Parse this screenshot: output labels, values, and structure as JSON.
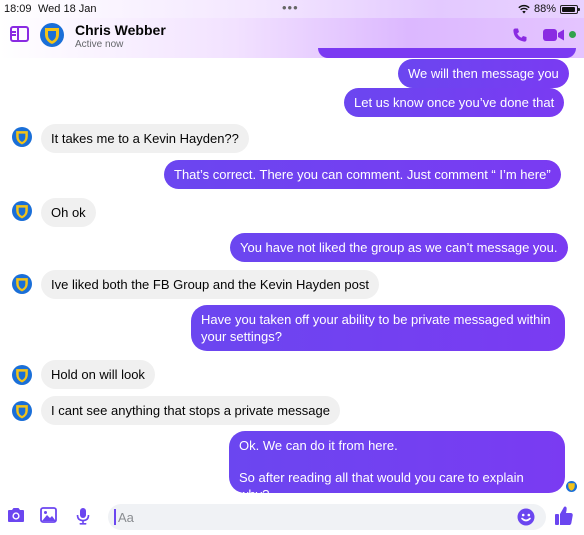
{
  "status_bar": {
    "time": "18:09",
    "date": "Wed 18 Jan",
    "dots": "•••",
    "battery": "88%"
  },
  "header": {
    "contact_name": "Chris Webber",
    "contact_status": "Active now",
    "icons": [
      "sidebar-toggle-icon",
      "avatar-shield-icon",
      "phone-icon",
      "video-camera-icon"
    ]
  },
  "colors": {
    "outgoing_bubble": "#7a3bf2",
    "incoming_bubble": "#f0f0f0",
    "accent": "#8a2be2",
    "active_dot": "#31a24c"
  },
  "messages": [
    {
      "direction": "outgoing",
      "text": "We will then message you"
    },
    {
      "direction": "outgoing",
      "text": "Let us know once you’ve done that"
    },
    {
      "direction": "incoming",
      "text": "It takes me to a Kevin Hayden??"
    },
    {
      "direction": "outgoing",
      "text": "That’s correct. There you can comment. Just comment “ I’m here”"
    },
    {
      "direction": "incoming",
      "text": "Oh ok"
    },
    {
      "direction": "outgoing",
      "text": "You have not liked the group as we can’t message you."
    },
    {
      "direction": "incoming",
      "text": "Ive liked both the FB Group and the Kevin Hayden post"
    },
    {
      "direction": "outgoing",
      "text": "Have you taken off your ability to be private messaged within your settings?"
    },
    {
      "direction": "incoming",
      "text": "Hold on will look"
    },
    {
      "direction": "incoming",
      "text": "I cant see anything that stops a private message"
    },
    {
      "direction": "outgoing",
      "text": "Ok. We can do it from here."
    },
    {
      "direction": "outgoing",
      "text": "So after reading all that would you care to explain why?"
    }
  ],
  "composer": {
    "placeholder": "Aa",
    "icons": [
      "camera-icon",
      "photo-icon",
      "microphone-icon",
      "emoji-icon",
      "thumbs-up-icon"
    ]
  }
}
